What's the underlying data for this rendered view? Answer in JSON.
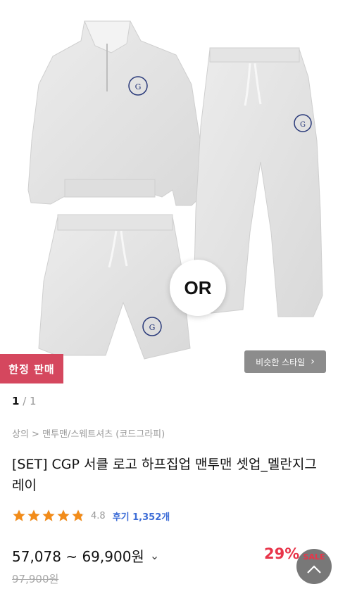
{
  "product": {
    "image_overlay_text": "OR",
    "badge": "한정 판매",
    "similar_style_button": "비슷한 스타일",
    "pager_current": "1",
    "pager_total": "/ 1",
    "breadcrumb": "상의 > 맨투맨/스웨트셔츠 (코드그라피)",
    "title": "[SET] CGP 서클 로고 하프집업 맨투맨 셋업_멜란지그레이",
    "rating": {
      "stars": 4.8,
      "score_label": "4.8",
      "reviews_label": "후기 1,352개"
    },
    "price_range": "57,078 ~ 69,900원",
    "original_price": "97,900원",
    "discount": "29%",
    "sale_label": "SALE"
  },
  "colors": {
    "badge": "#d5475e",
    "star": "#f28c1a",
    "reviews": "#3d6dd7",
    "discount": "#e8354a"
  },
  "icons": {
    "similar_chevron": "chevron-right-icon",
    "price_chevron": "chevron-down-icon",
    "scroll_top": "chevron-up-icon",
    "star": "star-icon"
  }
}
